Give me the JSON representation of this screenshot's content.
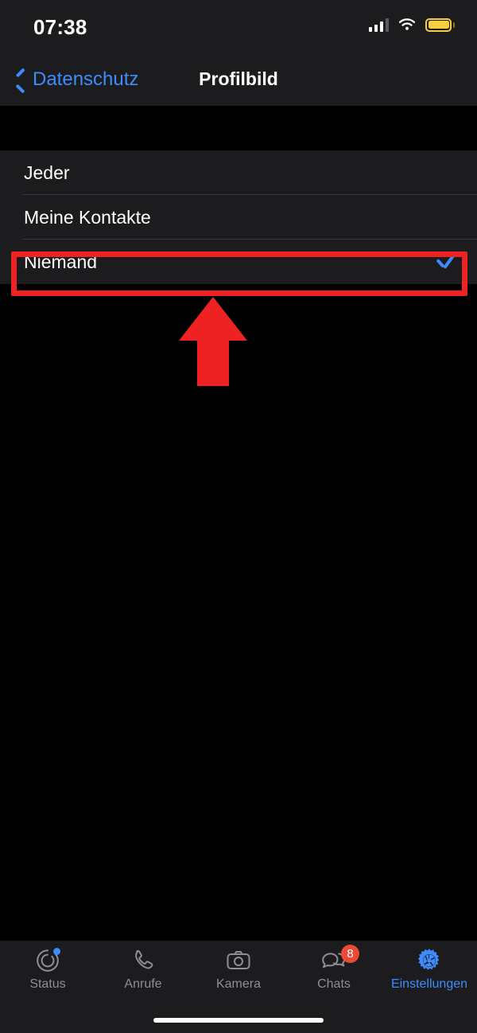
{
  "status_bar": {
    "time": "07:38",
    "signal_icon": "cellular-bars-icon",
    "wifi_icon": "wifi-icon",
    "battery_icon": "battery-low-power-icon",
    "battery_color": "#f5cf3f"
  },
  "nav_bar": {
    "back_label": "Datenschutz",
    "back_icon": "chevron-left-icon",
    "title": "Profilbild",
    "accent_color": "#3d8bfd"
  },
  "options": {
    "rows": [
      {
        "label": "Jeder",
        "selected": false
      },
      {
        "label": "Meine Kontakte",
        "selected": false
      },
      {
        "label": "Niemand",
        "selected": true
      }
    ],
    "check_icon": "checkmark-icon",
    "check_color": "#3d8bfd"
  },
  "annotations": {
    "highlight_color": "#ee2222",
    "highlight_target": "Niemand",
    "arrow_icon": "arrow-up-icon",
    "arrow_color": "#ee2222"
  },
  "tab_bar": {
    "active": "Einstellungen",
    "tabs": [
      {
        "label": "Status",
        "icon": "status-ring-icon",
        "badge": "",
        "dot": true
      },
      {
        "label": "Anrufe",
        "icon": "phone-icon",
        "badge": "",
        "dot": false
      },
      {
        "label": "Kamera",
        "icon": "camera-icon",
        "badge": "",
        "dot": false
      },
      {
        "label": "Chats",
        "icon": "chat-bubbles-icon",
        "badge": "8",
        "dot": false
      },
      {
        "label": "Einstellungen",
        "icon": "gear-icon",
        "badge": "",
        "dot": false
      }
    ],
    "inactive_color": "#8e8e93",
    "active_color": "#3d8bfd",
    "badge_color": "#eb4b36"
  },
  "home_indicator": "home-indicator"
}
